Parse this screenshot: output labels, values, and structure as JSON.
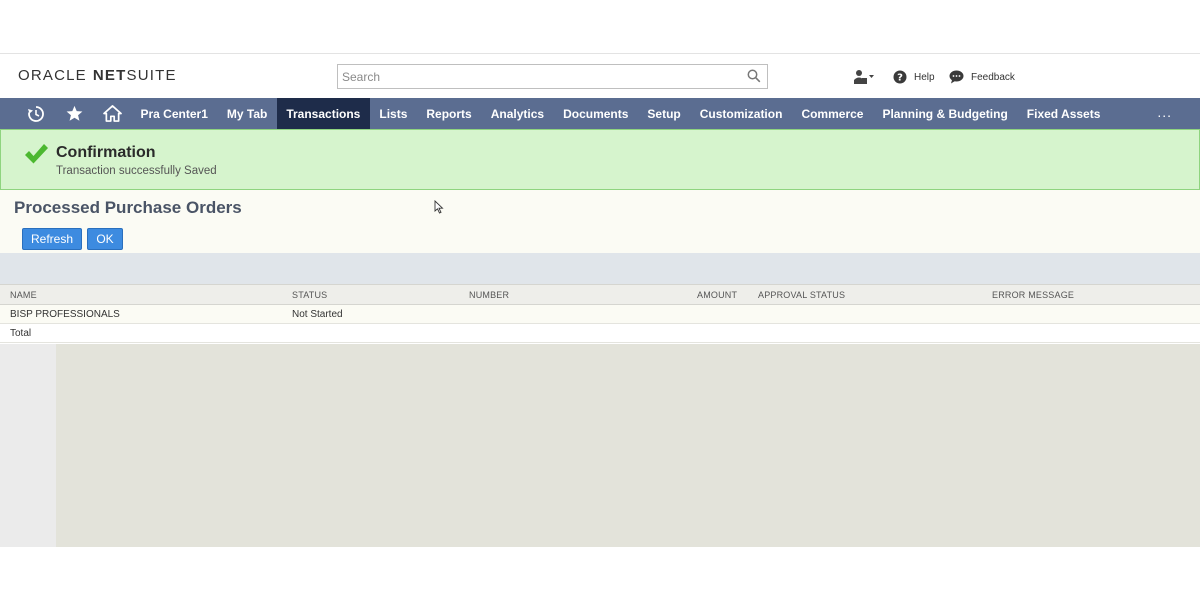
{
  "header": {
    "logo_oracle": "ORACLE",
    "logo_net": "NET",
    "logo_suite": "SUITE",
    "search_placeholder": "Search",
    "help_label": "Help",
    "feedback_label": "Feedback"
  },
  "nav": {
    "items": [
      {
        "label": "Pra Center1"
      },
      {
        "label": "My Tab"
      },
      {
        "label": "Transactions"
      },
      {
        "label": "Lists"
      },
      {
        "label": "Reports"
      },
      {
        "label": "Analytics"
      },
      {
        "label": "Documents"
      },
      {
        "label": "Setup"
      },
      {
        "label": "Customization"
      },
      {
        "label": "Commerce"
      },
      {
        "label": "Planning & Budgeting"
      },
      {
        "label": "Fixed Assets"
      }
    ],
    "active": "Transactions",
    "more_label": "..."
  },
  "confirmation": {
    "title": "Confirmation",
    "message": "Transaction successfully Saved"
  },
  "page": {
    "title": "Processed Purchase Orders",
    "refresh_label": "Refresh",
    "ok_label": "OK"
  },
  "table": {
    "columns": [
      "NAME",
      "STATUS",
      "NUMBER",
      "AMOUNT",
      "APPROVAL STATUS",
      "ERROR MESSAGE"
    ],
    "rows": [
      {
        "name": "BISP PROFESSIONALS",
        "status": "Not Started",
        "number": "",
        "amount": "",
        "approval_status": "",
        "error_message": ""
      }
    ],
    "total_label": "Total"
  },
  "colors": {
    "nav_bg": "#5b6d91",
    "nav_active": "#1e2c4a",
    "confirm_bg": "#d6f4cd",
    "button_blue": "#3d8be0"
  },
  "icons": [
    "recent-icon",
    "star-icon",
    "home-icon",
    "search-icon",
    "user-switch-icon",
    "help-icon",
    "feedback-icon",
    "check-icon"
  ]
}
